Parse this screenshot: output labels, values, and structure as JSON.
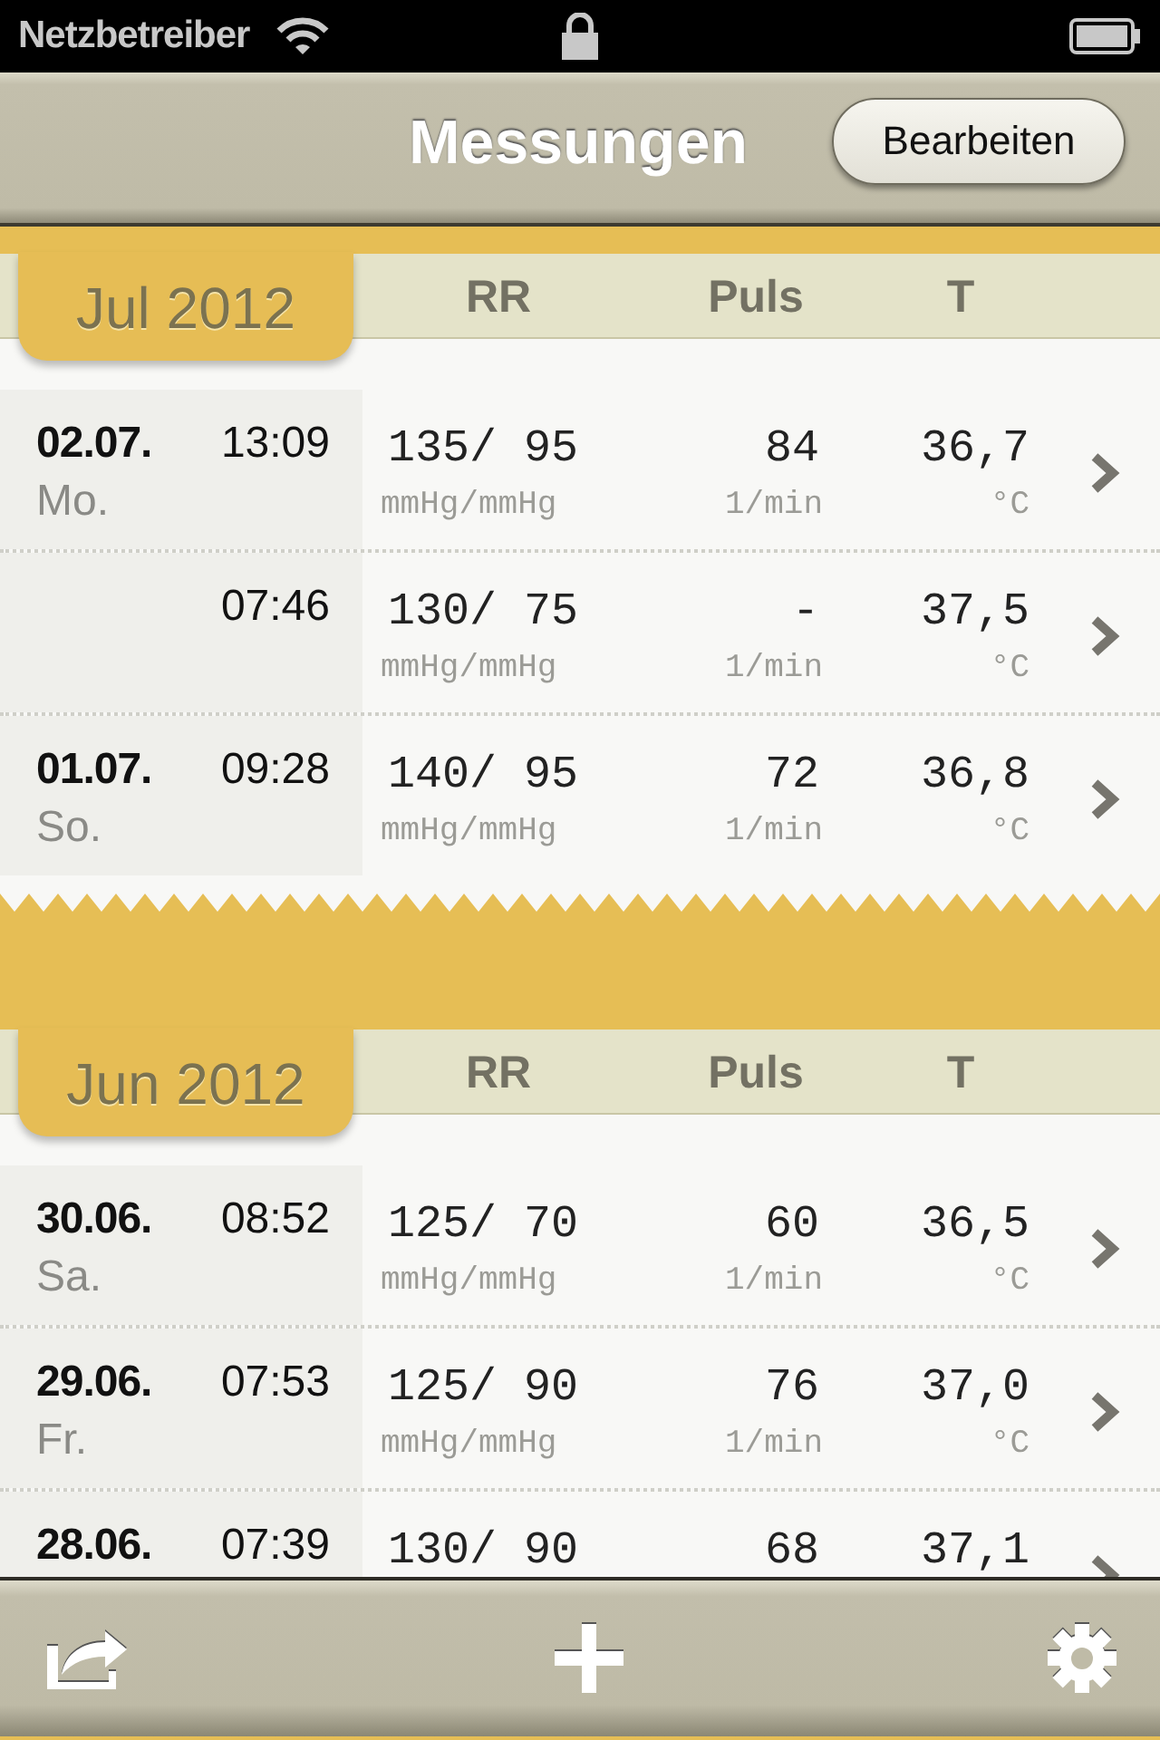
{
  "status_bar": {
    "carrier": "Netzbetreiber"
  },
  "nav_bar": {
    "title": "Messungen",
    "edit_button": "Bearbeiten"
  },
  "months": [
    {
      "label": "Jul 2012",
      "columns": [
        "RR",
        "Puls",
        "T"
      ],
      "torn_edge": true,
      "rows": [
        {
          "date": "02.07.",
          "weekday": "Mo.",
          "time": "13:09",
          "bp": "135/ 95",
          "bp_unit": "mmHg/mmHg",
          "pulse": "84",
          "pulse_unit": "1/min",
          "temp": "36,7",
          "temp_unit": "°C"
        },
        {
          "time": "07:46",
          "bp": "130/ 75",
          "bp_unit": "mmHg/mmHg",
          "pulse": "-",
          "pulse_unit": "1/min",
          "temp": "37,5",
          "temp_unit": "°C"
        },
        {
          "date": "01.07.",
          "weekday": "So.",
          "time": "09:28",
          "bp": "140/ 95",
          "bp_unit": "mmHg/mmHg",
          "pulse": "72",
          "pulse_unit": "1/min",
          "temp": "36,8",
          "temp_unit": "°C"
        }
      ]
    },
    {
      "label": "Jun 2012",
      "columns": [
        "RR",
        "Puls",
        "T"
      ],
      "torn_edge": false,
      "rows": [
        {
          "date": "30.06.",
          "weekday": "Sa.",
          "time": "08:52",
          "bp": "125/ 70",
          "bp_unit": "mmHg/mmHg",
          "pulse": "60",
          "pulse_unit": "1/min",
          "temp": "36,5",
          "temp_unit": "°C"
        },
        {
          "date": "29.06.",
          "weekday": "Fr.",
          "time": "07:53",
          "bp": "125/ 90",
          "bp_unit": "mmHg/mmHg",
          "pulse": "76",
          "pulse_unit": "1/min",
          "temp": "37,0",
          "temp_unit": "°C"
        },
        {
          "date": "28.06.",
          "time": "07:39",
          "bp": "130/ 90",
          "pulse": "68",
          "temp": "37,1"
        }
      ]
    }
  ]
}
